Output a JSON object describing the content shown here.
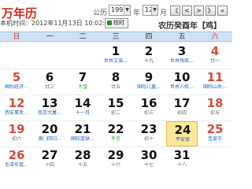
{
  "header": {
    "brand": "万年历",
    "year_label": "公历",
    "year_value": "1993",
    "year_suffix": "年",
    "month_value": "12",
    "month_suffix": "月",
    "nav": [
      "《",
      "<",
      ">",
      "》",
      "«"
    ],
    "current_time": "本机时间：2012年11月13日  10:02:27",
    "sync_label": "校时",
    "lunar_header": "农历癸酉年【鸡】"
  },
  "weekdays": [
    "日",
    "一",
    "二",
    "三",
    "四",
    "五",
    "六"
  ],
  "weeks": [
    [
      {
        "n": "",
        "s": ""
      },
      {
        "n": "",
        "s": ""
      },
      {
        "n": "",
        "s": ""
      },
      {
        "n": "1",
        "s": "世界艾滋…",
        "t": "fest"
      },
      {
        "n": "2",
        "s": "十九"
      },
      {
        "n": "3",
        "s": "世界残疾…",
        "t": "fest"
      },
      {
        "n": "4",
        "s": "廿一"
      }
    ],
    [
      {
        "n": "5",
        "s": "国际经济…",
        "t": "fest",
        "red": true
      },
      {
        "n": "6",
        "s": "廿三"
      },
      {
        "n": "7",
        "s": "大雪",
        "t": "green"
      },
      {
        "n": "8",
        "s": "廿五"
      },
      {
        "n": "9",
        "s": "国际儿童…",
        "t": "fest"
      },
      {
        "n": "10",
        "s": "世界人权…",
        "t": "fest"
      },
      {
        "n": "11",
        "s": "国际山岳…",
        "t": "fest"
      }
    ],
    [
      {
        "n": "12",
        "s": "西安事变…",
        "t": "fest",
        "red": true
      },
      {
        "n": "13",
        "s": "南京大屠…",
        "t": "fest"
      },
      {
        "n": "14",
        "s": "十一月",
        "t": "fest"
      },
      {
        "n": "15",
        "s": "初二"
      },
      {
        "n": "16",
        "s": "初三"
      },
      {
        "n": "17",
        "s": "初四"
      },
      {
        "n": "18",
        "s": "初五"
      }
    ],
    [
      {
        "n": "19",
        "s": "初六",
        "red": true
      },
      {
        "n": "20",
        "s": "澳门回归…",
        "t": "fest"
      },
      {
        "n": "21",
        "s": "国际篮球…",
        "t": "fest"
      },
      {
        "n": "22",
        "s": "冬至",
        "t": "green"
      },
      {
        "n": "23",
        "s": "初十"
      },
      {
        "n": "24",
        "s": "平安夜",
        "t": "fest",
        "today": true
      },
      {
        "n": "25",
        "s": "圣诞节",
        "t": "fest"
      }
    ],
    [
      {
        "n": "26",
        "s": "毛泽东诞…",
        "t": "fest",
        "red": true
      },
      {
        "n": "27",
        "s": "十四"
      },
      {
        "n": "28",
        "s": "十五"
      },
      {
        "n": "29",
        "s": "十六"
      },
      {
        "n": "30",
        "s": "十七"
      },
      {
        "n": "31",
        "s": "十八"
      },
      {
        "n": "",
        "s": ""
      }
    ]
  ]
}
